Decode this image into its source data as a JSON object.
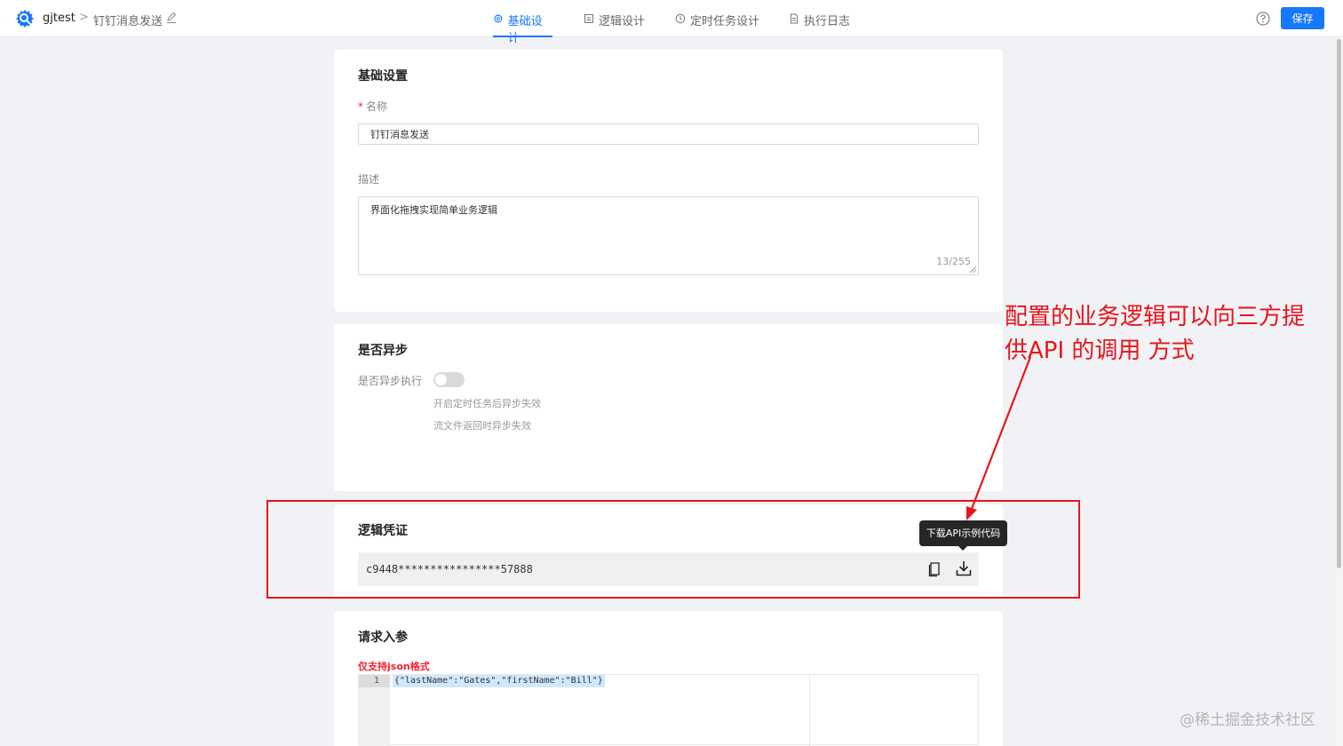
{
  "header": {
    "app_name": "gjtest",
    "breadcrumb_separator": ">",
    "page_name": "钉钉消息发送",
    "tabs": [
      {
        "label": "基础设计",
        "icon": "gear-icon",
        "active": true
      },
      {
        "label": "逻辑设计",
        "icon": "logic-icon",
        "active": false
      },
      {
        "label": "定时任务设计",
        "icon": "clock-icon",
        "active": false
      },
      {
        "label": "执行日志",
        "icon": "document-icon",
        "active": false
      }
    ],
    "save_label": "保存"
  },
  "basic": {
    "title": "基础设置",
    "required_mark": "*",
    "name_label": "名称",
    "name_value": "钉钉消息发送",
    "desc_label": "描述",
    "desc_value": "界面化拖拽实现简单业务逻辑",
    "char_count": "13/255"
  },
  "async": {
    "title": "是否异步",
    "toggle_label": "是否异步执行",
    "toggle_on": false,
    "hints": [
      "开启定时任务后异步失效",
      "流文件返回时异步失效"
    ]
  },
  "credential": {
    "title": "逻辑凭证",
    "token": "c9448****************57888",
    "tooltip": "下载API示例代码"
  },
  "request": {
    "title": "请求入参",
    "note": "仅支持json格式",
    "line_number": "1",
    "code": "{\"lastName\":\"Gates\",\"firstName\":\"Bill\"}"
  },
  "annotation": {
    "text_line1": "配置的业务逻辑可以向三方提",
    "text_line2": "供API 的调用  方式"
  },
  "watermark": {
    "brand": "@稀土掘金技术社区"
  },
  "colors": {
    "primary": "#1677ff",
    "annotation_red": "#e8141a"
  }
}
